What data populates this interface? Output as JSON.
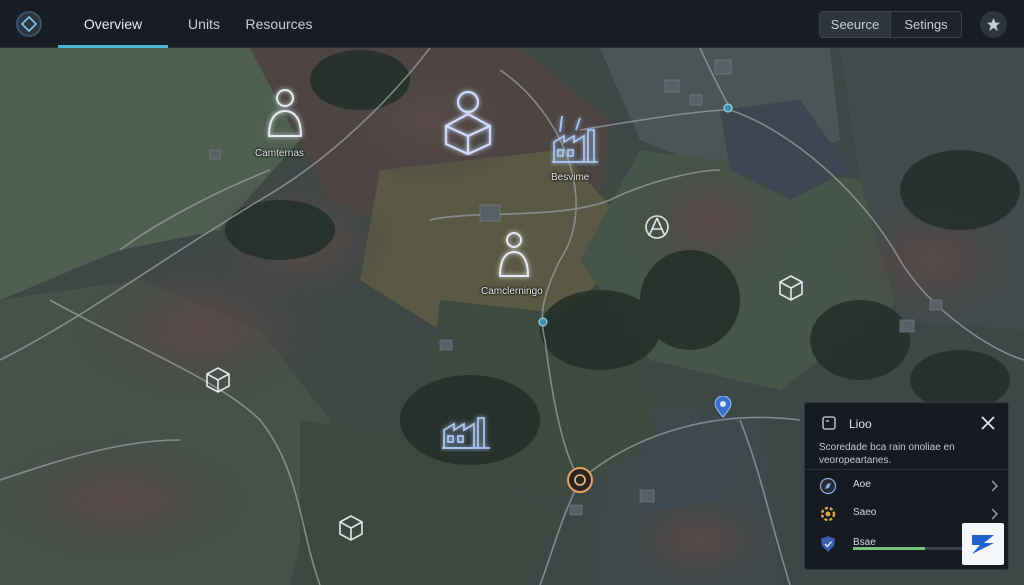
{
  "nav": {
    "tabs": [
      {
        "label": "Overview",
        "active": true
      },
      {
        "label": "Units",
        "active": false
      },
      {
        "label": "Resources",
        "active": false
      }
    ],
    "segment": {
      "left": "Seeurce",
      "right": "Setings"
    },
    "logo_icon": "diamond-logo-icon",
    "profile_icon": "star-badge-icon"
  },
  "map": {
    "labels": {
      "camp_top": "Camternas",
      "factory_top": "Besvime",
      "camp_center": "Camclerningo"
    },
    "markers": [
      "person-marker-icon",
      "cube-marker-icon",
      "factory-marker-icon",
      "tripod-marker-icon",
      "box-marker-icon",
      "location-pin-icon",
      "target-marker-icon"
    ]
  },
  "panel": {
    "title": "Lioo",
    "description": "Scoredade bca rain onoliae en veoropeartanes.",
    "rows": [
      {
        "label": "Aoe",
        "icon": "compass-icon"
      },
      {
        "label": "Saeo",
        "icon": "gear-icon"
      },
      {
        "label": "Bsae",
        "icon": "shield-icon",
        "progress": 0.6
      }
    ]
  },
  "colors": {
    "accent": "#49b6d8",
    "panel_bg": "#161a21",
    "topbar_bg": "#181c23",
    "progress": "#7bc27a"
  }
}
